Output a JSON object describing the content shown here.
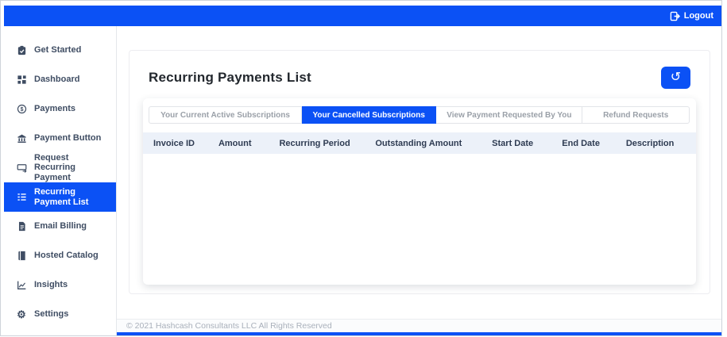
{
  "topbar": {
    "logout_label": "Logout"
  },
  "sidebar": {
    "items": [
      {
        "label": "Get Started"
      },
      {
        "label": "Dashboard"
      },
      {
        "label": "Payments"
      },
      {
        "label": "Payment Button"
      },
      {
        "label": "Request Recurring Payment"
      },
      {
        "label": "Recurring Payment List"
      },
      {
        "label": "Email Billing"
      },
      {
        "label": "Hosted Catalog"
      },
      {
        "label": "Insights"
      },
      {
        "label": "Settings"
      }
    ],
    "active_item": "Recurring Payment List"
  },
  "main": {
    "title": "Recurring Payments List",
    "history_icon": "↺",
    "tabs": [
      {
        "label": "Your Current Active Subscriptions",
        "active": false
      },
      {
        "label": "Your Cancelled Subscriptions",
        "active": true
      },
      {
        "label": "View Payment Requested By You",
        "active": false
      },
      {
        "label": "Refund Requests",
        "active": false
      }
    ],
    "table": {
      "columns": [
        "Invoice ID",
        "Amount",
        "Recurring Period",
        "Outstanding Amount",
        "Start Date",
        "End Date",
        "Description"
      ],
      "rows": []
    }
  },
  "footer": {
    "copyright": "© 2021 Hashcash Consultants LLC All Rights Reserved"
  },
  "colors": {
    "primary_blue": "#0b51f5",
    "table_header_bg": "#ecf1f9",
    "sidebar_text": "#3f4d63"
  }
}
